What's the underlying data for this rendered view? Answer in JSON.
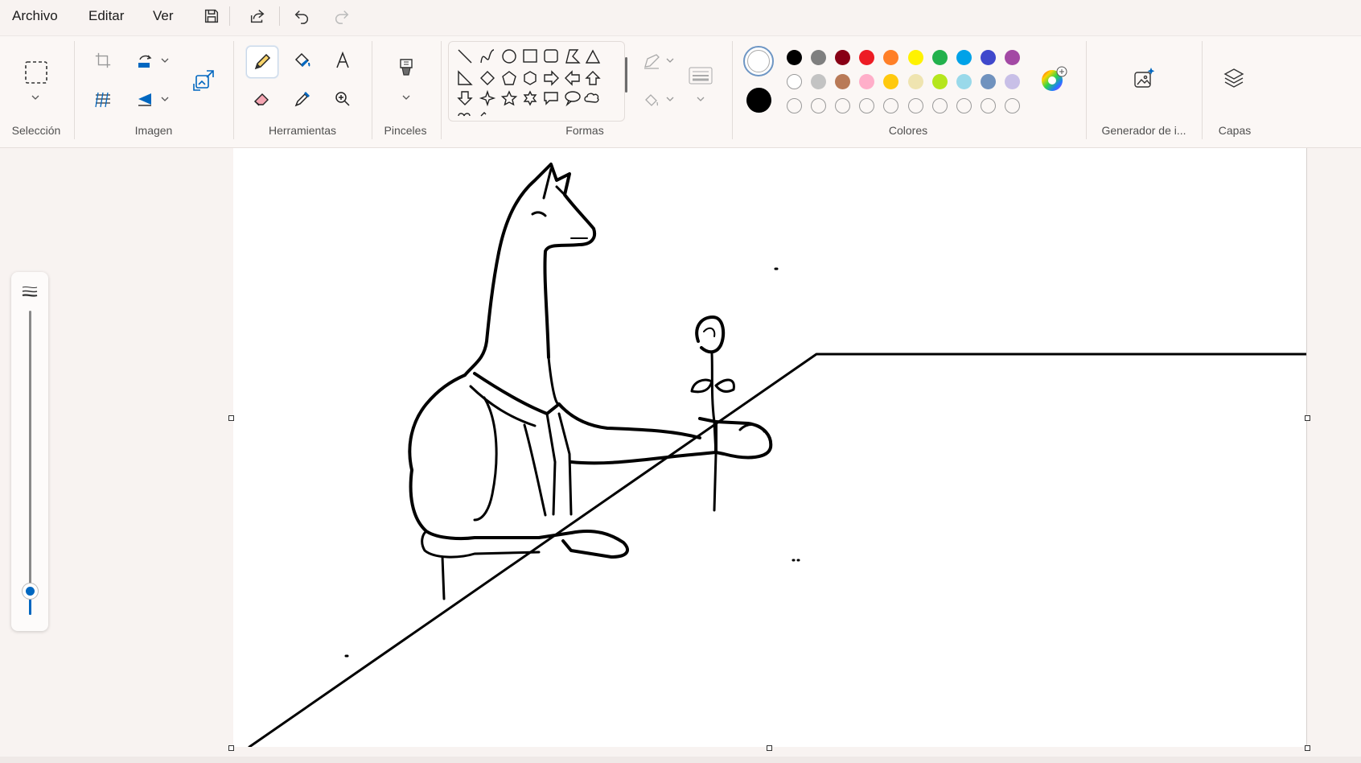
{
  "menubar": {
    "file": "Archivo",
    "edit": "Editar",
    "view": "Ver",
    "quick_icons": [
      "save-icon",
      "share-icon",
      "undo-icon",
      "redo-icon"
    ]
  },
  "ribbon": {
    "groups": {
      "selection": "Selección",
      "image": "Imagen",
      "tools": "Herramientas",
      "brushes": "Pinceles",
      "shapes": "Formas",
      "colors": "Colores",
      "generator": "Generador de i...",
      "layers": "Capas"
    },
    "selected_tool": "pencil",
    "shapes_list": [
      "line",
      "curve",
      "oval",
      "rectangle",
      "rounded-rectangle",
      "polygon",
      "triangle",
      "right-triangle",
      "diamond",
      "pentagon",
      "hexagon",
      "right-arrow",
      "left-arrow",
      "up-arrow",
      "down-arrow",
      "four-point-star",
      "five-point-star",
      "six-point-star",
      "rounded-rectangle-callout",
      "oval-callout",
      "cloud-callout",
      "heart",
      "lightning"
    ],
    "colors": {
      "primary": "#000000",
      "secondary": "#ffffff",
      "row1": [
        "#000000",
        "#7f7f7f",
        "#880015",
        "#ed1c24",
        "#ff7f27",
        "#fff200",
        "#22b14c",
        "#00a2e8",
        "#3f48cc",
        "#a349a4"
      ],
      "row2": [
        "#ffffff",
        "#c3c3c3",
        "#b97a57",
        "#ffaec9",
        "#ffc90e",
        "#efe4b0",
        "#b5e61d",
        "#99d9ea",
        "#7092be",
        "#c8bfe7"
      ],
      "row3_custom_empty": 10,
      "accent": "#0067c0"
    }
  },
  "size_slider": {
    "level_fraction": 0.08
  },
  "canvas": {
    "drawing_subject": "llama holding a rose at a table",
    "background": "#ffffff"
  }
}
